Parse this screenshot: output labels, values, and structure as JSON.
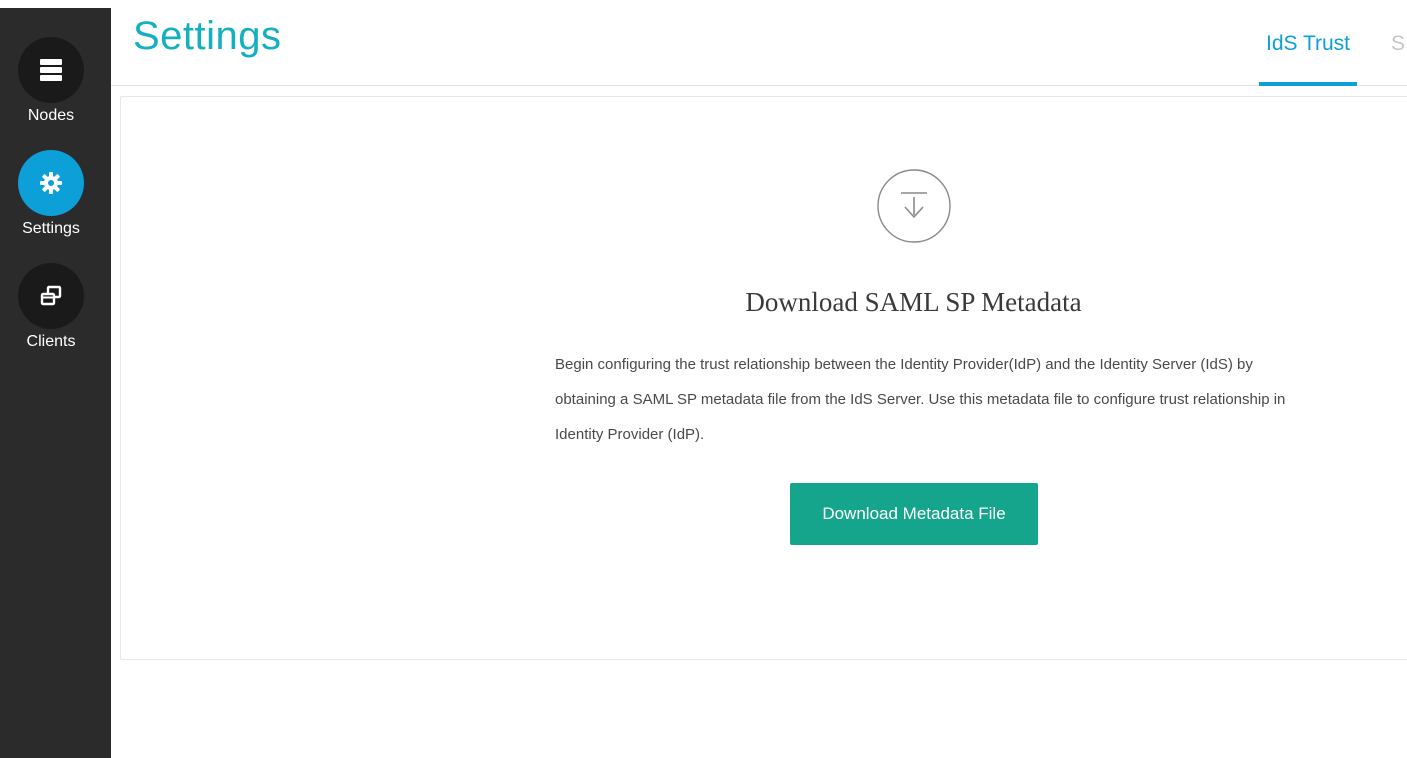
{
  "nav": {
    "items": [
      {
        "label": "Nodes",
        "icon": "server-icon",
        "active": false
      },
      {
        "label": "Settings",
        "icon": "gear-icon",
        "active": true
      },
      {
        "label": "Clients",
        "icon": "windows-stack-icon",
        "active": false
      }
    ]
  },
  "header": {
    "title": "Settings",
    "tabs": [
      {
        "label": "IdS Trust",
        "active": true
      },
      {
        "label": "S",
        "active": false
      }
    ]
  },
  "card": {
    "icon": "download-icon",
    "title": "Download SAML SP Metadata",
    "description": "Begin configuring the trust relationship between the Identity Provider(IdP) and the Identity Server (IdS) by obtaining a SAML SP metadata file from the IdS Server. Use this metadata file to configure trust relationship in Identity Provider (IdP).",
    "button_label": "Download Metadata File"
  },
  "colors": {
    "rail_bg": "#2b2b2b",
    "active_blue": "#0d9fd8",
    "title_teal": "#14b0c2",
    "button_green": "#15a58c"
  }
}
